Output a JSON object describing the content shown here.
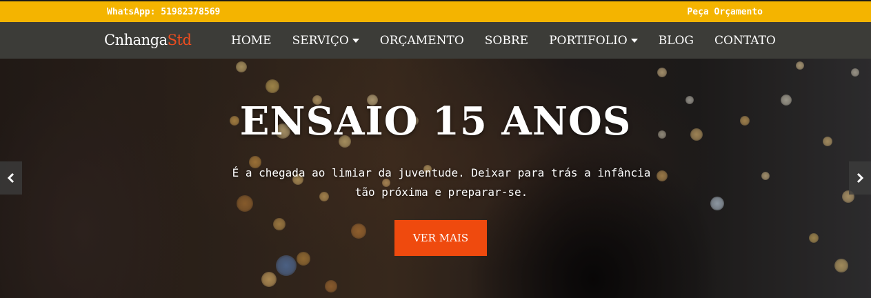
{
  "topbar": {
    "whatsapp": "WhatsApp: 51982378569",
    "quote_link": "Peça Orçamento",
    "color": "#f4b400"
  },
  "navbar": {
    "brand_main": "Cnhanga",
    "brand_accent": "Std",
    "accent_color": "#ee4d1f",
    "items": [
      {
        "label": "HOME",
        "dropdown": false
      },
      {
        "label": "SERVIÇO",
        "dropdown": true
      },
      {
        "label": "ORÇAMENTO",
        "dropdown": false
      },
      {
        "label": "SOBRE",
        "dropdown": false
      },
      {
        "label": "PORTIFOLIO",
        "dropdown": true
      },
      {
        "label": "BLOG",
        "dropdown": false
      },
      {
        "label": "CONTATO",
        "dropdown": false
      }
    ]
  },
  "hero": {
    "title": "ENSAIO 15 ANOS",
    "line1": "É a chegada ao limiar da juventude. Deixar para trás a infância",
    "line2": "tão próxima e preparar-se.",
    "button": "VER MAIS",
    "button_color": "#ef4a0e",
    "prev_icon": "chevron-left-icon",
    "next_icon": "chevron-right-icon"
  }
}
